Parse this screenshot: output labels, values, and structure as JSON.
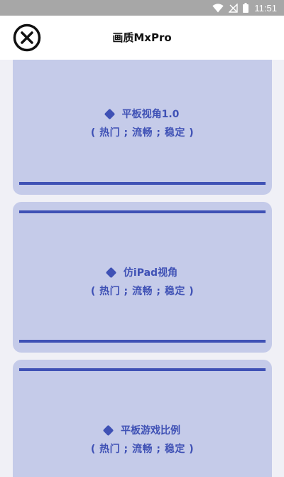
{
  "status_bar": {
    "time": "11:51",
    "icons": [
      "wifi-icon",
      "no-signal-icon",
      "battery-icon"
    ]
  },
  "header": {
    "title": "画质MxPro",
    "close_icon": "close-circle-icon"
  },
  "options": [
    {
      "label": "平板视角1.0",
      "tags": "( 热门 ; 流畅 ; 稳定 )"
    },
    {
      "label": "仿iPad视角",
      "tags": "( 热门 ; 流畅 ; 稳定 )"
    },
    {
      "label": "平板游戏比例",
      "tags": "( 热门 ; 流畅 ; 稳定 )"
    }
  ],
  "colors": {
    "accent": "#3f51b5",
    "card_background": "#c5cbe9",
    "page_background": "#f0f0f6",
    "status_bar": "#a7a7a7"
  }
}
